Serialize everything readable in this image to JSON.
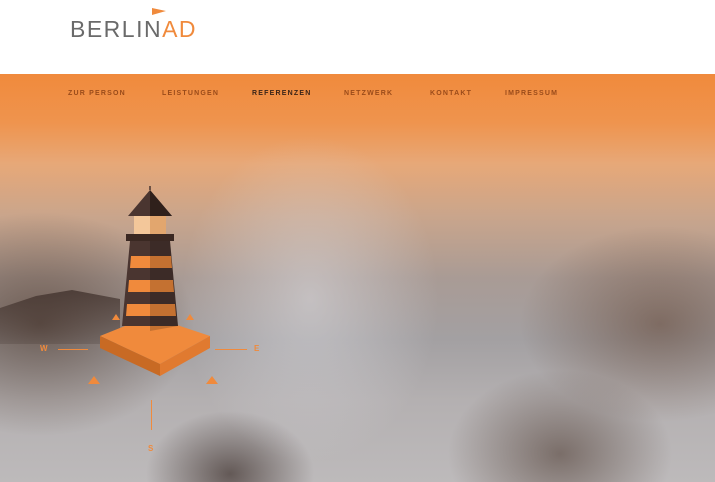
{
  "header": {
    "logo_main": "BERLIN",
    "logo_accent": "AD"
  },
  "nav": {
    "items": [
      {
        "label": "ZUR PERSON",
        "active": false
      },
      {
        "label": "LEISTUNGEN",
        "active": false
      },
      {
        "label": "REFERENZEN",
        "active": true
      },
      {
        "label": "NETZWERK",
        "active": false
      },
      {
        "label": "KONTAKT",
        "active": false
      },
      {
        "label": "IMPRESSUM",
        "active": false
      }
    ]
  },
  "hero": {
    "compass": {
      "west": "W",
      "east": "E",
      "south": "S"
    },
    "illustration": "lighthouse-icon"
  },
  "colors": {
    "accent": "#f08a3c",
    "logo_gray": "#6a6a6a",
    "nav_text": "#9a4b1a",
    "nav_active": "#3b2418"
  }
}
